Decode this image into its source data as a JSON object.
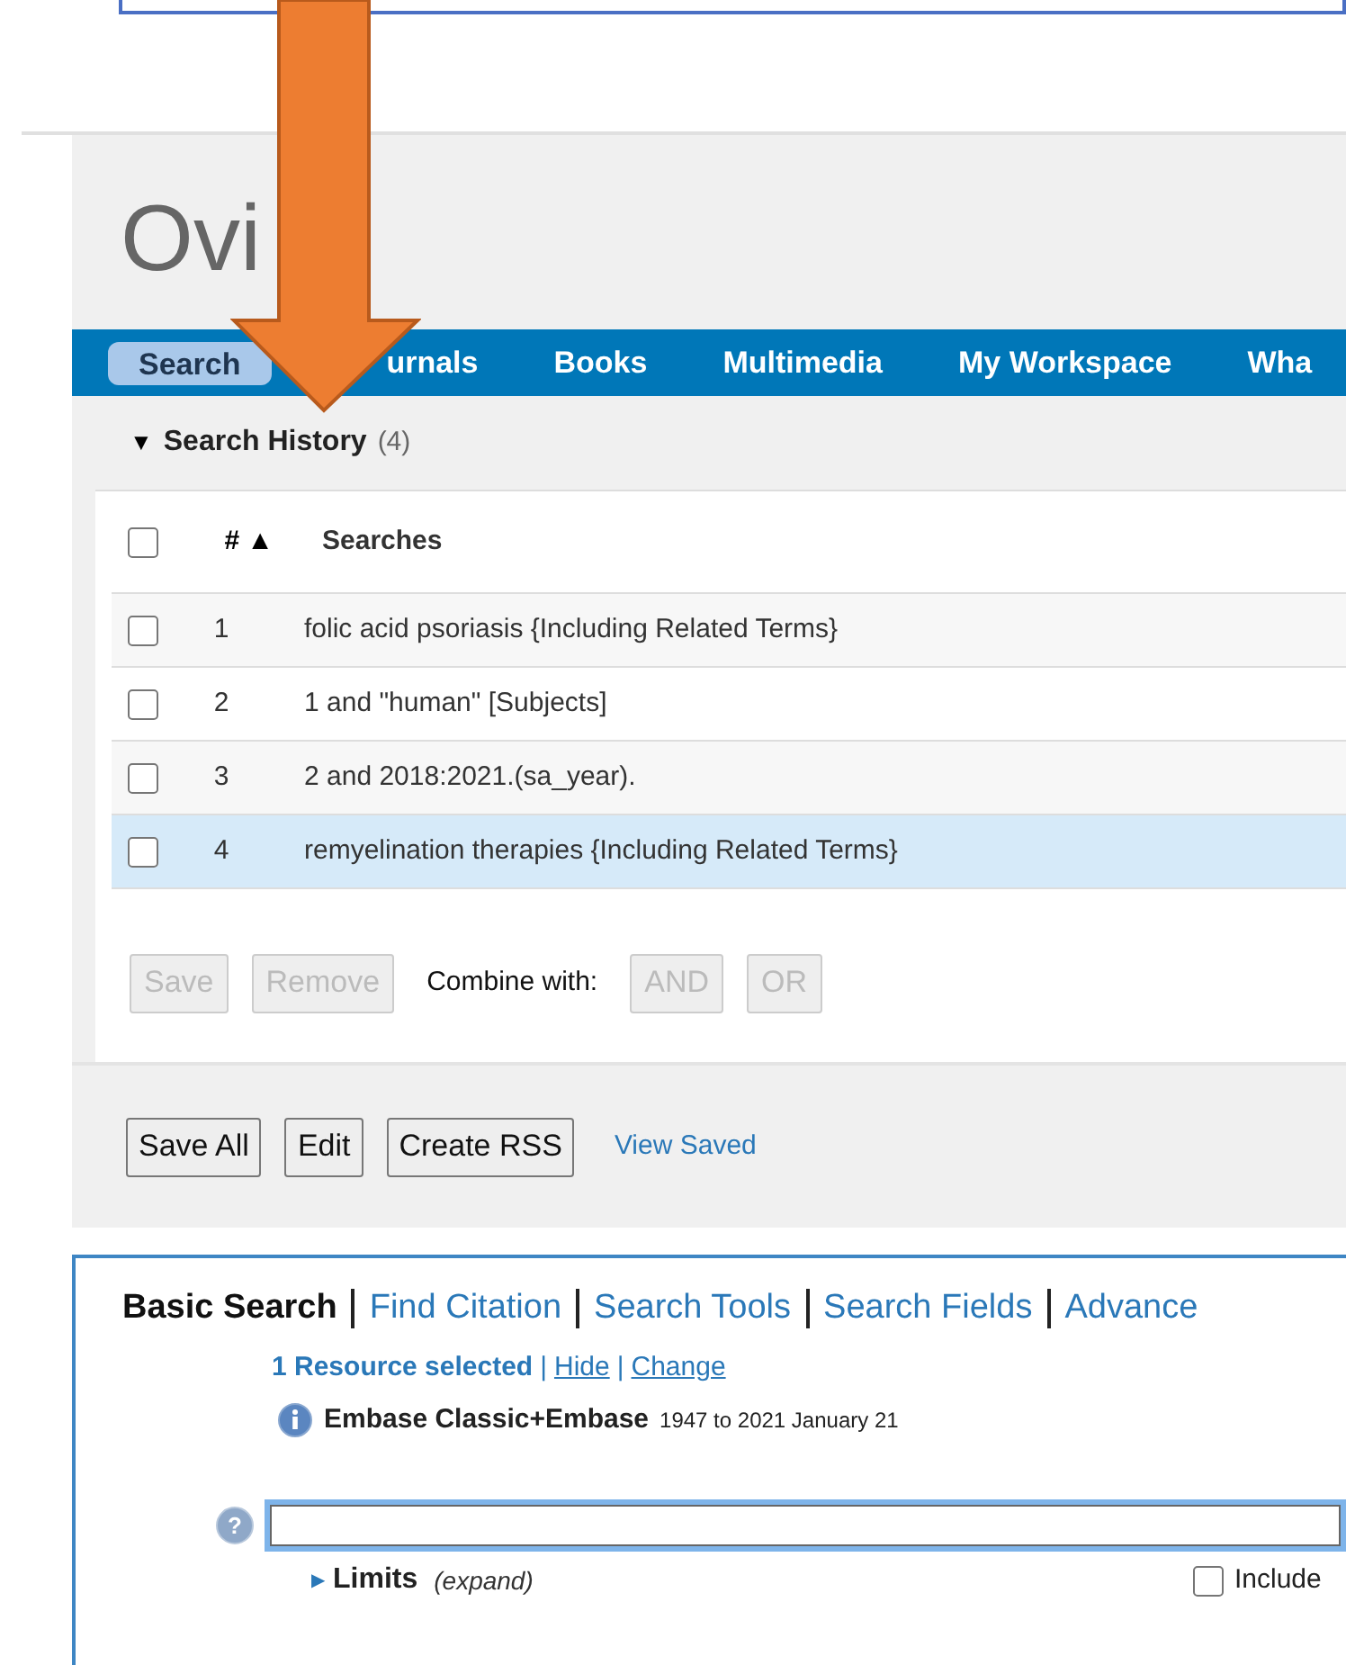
{
  "logo": {
    "text": "Ovi"
  },
  "nav": [
    {
      "label": "Search",
      "selected": true
    },
    {
      "label": "urnals",
      "selected": false
    },
    {
      "label": "Books",
      "selected": false
    },
    {
      "label": "Multimedia",
      "selected": false
    },
    {
      "label": "My Workspace",
      "selected": false
    },
    {
      "label": "Wha",
      "selected": false
    }
  ],
  "history": {
    "toggle": "▼",
    "title": "Search History",
    "count": "(4)",
    "columns": [
      "#",
      "Searches"
    ],
    "sort_mark": "▲",
    "all_checked": false,
    "rows": [
      {
        "number": "1",
        "query": "folic acid psoriasis {Including Related Terms}",
        "checked": false,
        "selected": false
      },
      {
        "number": "2",
        "query": "1 and \"human\" [Subjects]",
        "checked": false,
        "selected": false
      },
      {
        "number": "3",
        "query": "2 and 2018:2021.(sa_year).",
        "checked": false,
        "selected": false
      },
      {
        "number": "4",
        "query": "remyelination therapies {Including Related Terms}",
        "checked": false,
        "selected": true
      }
    ],
    "actions": [
      {
        "kind": "button",
        "label": "Save",
        "disabled": true
      },
      {
        "kind": "button",
        "label": "Remove",
        "disabled": true
      },
      {
        "kind": "text",
        "label": "Combine with:"
      },
      {
        "kind": "button",
        "label": "AND",
        "disabled": true
      },
      {
        "kind": "button",
        "label": "OR",
        "disabled": true
      }
    ],
    "footer": [
      {
        "kind": "button",
        "label": "Save All"
      },
      {
        "kind": "button",
        "label": "Edit"
      },
      {
        "kind": "button",
        "label": "Create RSS"
      },
      {
        "kind": "link",
        "label": "View Saved"
      }
    ]
  },
  "search_panel": {
    "tabs": [
      {
        "label": "Basic Search",
        "selected": true
      },
      {
        "label": "Find Citation",
        "selected": false
      },
      {
        "label": "Search Tools",
        "selected": false
      },
      {
        "label": "Search Fields",
        "selected": false
      },
      {
        "label": "Advance",
        "selected": false
      }
    ],
    "resources": {
      "summary": "1 Resource selected",
      "links": [
        {
          "separator": "|",
          "label": "Hide"
        },
        {
          "separator": "|",
          "label": "Change"
        }
      ]
    },
    "database": {
      "name": "Embase Classic+Embase",
      "range": "1947 to 2021 January 21"
    },
    "help_mark": "?",
    "limits": {
      "toggle": "▶",
      "label": "Limits",
      "hint": "(expand)"
    },
    "include": {
      "label": "Include",
      "checked": false
    }
  }
}
